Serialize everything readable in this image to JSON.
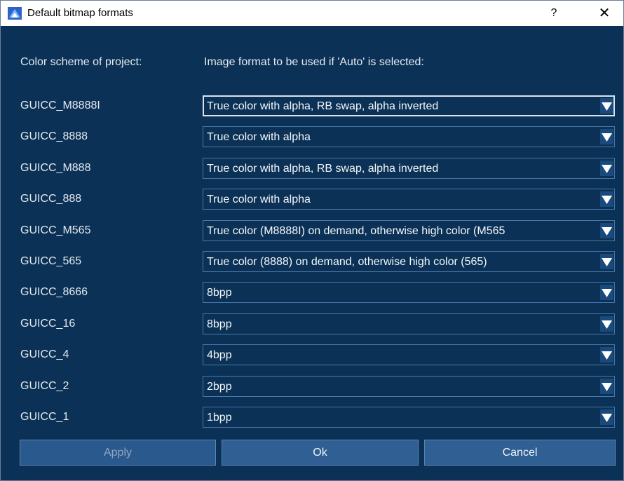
{
  "window": {
    "title": "Default bitmap formats",
    "help_label": "?",
    "close_label": "✕"
  },
  "headers": {
    "left": "Color scheme of project:",
    "right": "Image format to be used if 'Auto' is selected:"
  },
  "rows": [
    {
      "label": "GUICC_M8888I",
      "value": "True color with alpha, RB swap, alpha inverted"
    },
    {
      "label": "GUICC_8888",
      "value": "True color with alpha"
    },
    {
      "label": "GUICC_M888",
      "value": "True color with alpha, RB swap, alpha inverted"
    },
    {
      "label": "GUICC_888",
      "value": "True color with alpha"
    },
    {
      "label": "GUICC_M565",
      "value": "True color (M8888I) on demand, otherwise high color (M565"
    },
    {
      "label": "GUICC_565",
      "value": "True color (8888) on demand, otherwise high color (565)"
    },
    {
      "label": "GUICC_8666",
      "value": "8bpp"
    },
    {
      "label": "GUICC_16",
      "value": "8bpp"
    },
    {
      "label": "GUICC_4",
      "value": "4bpp"
    },
    {
      "label": "GUICC_2",
      "value": "2bpp"
    },
    {
      "label": "GUICC_1",
      "value": "1bpp"
    }
  ],
  "buttons": {
    "apply": "Apply",
    "ok": "Ok",
    "cancel": "Cancel"
  },
  "colors": {
    "background": "#0b3256",
    "accent": "#2f5f93",
    "border": "#4a76a8"
  }
}
